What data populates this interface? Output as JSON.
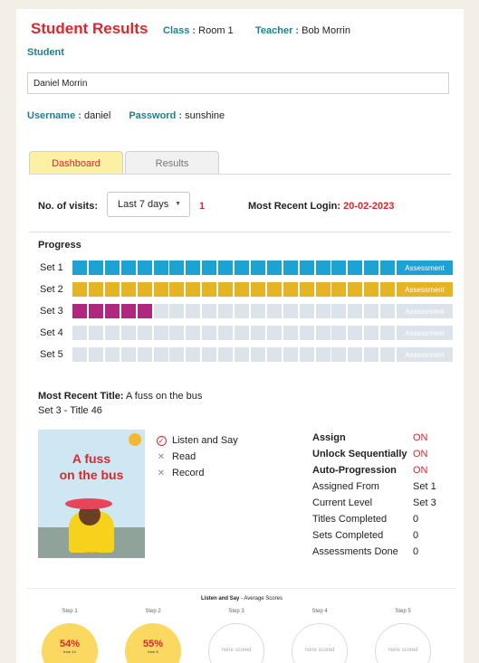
{
  "header": {
    "title": "Student Results",
    "class_label": "Class",
    "class_value": "Room 1",
    "teacher_label": "Teacher",
    "teacher_value": "Bob Morrin"
  },
  "student": {
    "label": "Student",
    "value": "Daniel Morrin",
    "username_label": "Username",
    "username": "daniel",
    "password_label": "Password",
    "password": "sunshine"
  },
  "tabs": [
    {
      "label": "Dashboard",
      "active": true
    },
    {
      "label": "Results",
      "active": false
    }
  ],
  "visits": {
    "label": "No. of visits:",
    "selected": "Last 7 days",
    "count": "1",
    "login_label": "Most Recent Login:",
    "login_date": "20-02-2023"
  },
  "progress": {
    "title": "Progress",
    "segments_per_set": 20,
    "assessment_label": "Assessment",
    "sets": [
      {
        "label": "Set 1",
        "completed": 20,
        "color": "#1ca3d3",
        "assessment_done": true
      },
      {
        "label": "Set 2",
        "completed": 20,
        "color": "#e4b424",
        "assessment_done": true
      },
      {
        "label": "Set 3",
        "completed": 5,
        "color": "#b0277f",
        "assessment_done": false
      },
      {
        "label": "Set 4",
        "completed": 0,
        "color": "#b0277f",
        "assessment_done": false
      },
      {
        "label": "Set 5",
        "completed": 0,
        "color": "#b0277f",
        "assessment_done": false
      }
    ],
    "empty_color": "#dde3ea"
  },
  "recent": {
    "label": "Most Recent Title:",
    "title": "A fuss on the bus",
    "subtitle": "Set 3 - Title 46",
    "cover_line1": "A fuss",
    "cover_line2": "on the bus"
  },
  "activities": [
    {
      "label": "Listen and Say",
      "done": true
    },
    {
      "label": "Read",
      "done": false
    },
    {
      "label": "Record",
      "done": false
    }
  ],
  "stats": [
    {
      "label": "Assign",
      "value": "ON",
      "bold": true,
      "red": true
    },
    {
      "label": "Unlock Sequentially",
      "value": "ON",
      "bold": true,
      "red": true
    },
    {
      "label": "Auto-Progression",
      "value": "ON",
      "bold": true,
      "red": true
    },
    {
      "label": "Assigned From",
      "value": "Set 1",
      "bold": false,
      "red": false
    },
    {
      "label": "Current Level",
      "value": "Set 3",
      "bold": false,
      "red": false
    },
    {
      "label": "Titles Completed",
      "value": "0",
      "bold": false,
      "red": false
    },
    {
      "label": "Sets Completed",
      "value": "0",
      "bold": false,
      "red": false
    },
    {
      "label": "Assessments Done",
      "value": "0",
      "bold": false,
      "red": false
    }
  ],
  "scores": {
    "title": "Listen and Say",
    "subtitle": "- Average Scores",
    "steps": [
      {
        "label": "Step 1",
        "value": "54%",
        "from": "from 14",
        "scored": true
      },
      {
        "label": "Step 2",
        "value": "55%",
        "from": "from 8",
        "scored": true
      },
      {
        "label": "Step 3",
        "value": "none scored",
        "from": "",
        "scored": false
      },
      {
        "label": "Step 4",
        "value": "none scored",
        "from": "",
        "scored": false
      },
      {
        "label": "Step 5",
        "value": "none scored",
        "from": "",
        "scored": false
      }
    ]
  }
}
